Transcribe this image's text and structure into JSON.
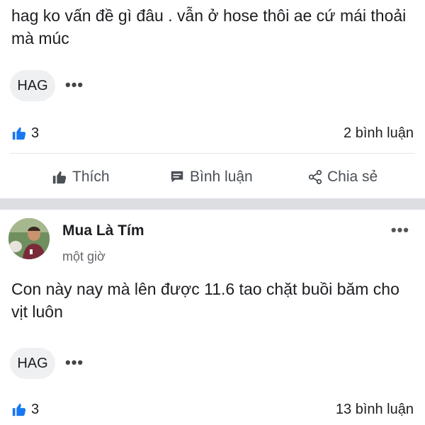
{
  "post1": {
    "body": "hag ko vấn đề gì đâu . vẫn ở hose thôi ae cứ mái thoải mà múc",
    "tag": "HAG",
    "more": "•••",
    "likes": "3",
    "comments": "2 bình luận",
    "actions": {
      "like": "Thích",
      "comment": "Bình luận",
      "share": "Chia sẻ"
    }
  },
  "post2": {
    "author": "Mua Là Tím",
    "time": "một giờ",
    "more": "•••",
    "body": "Con này nay mà lên được 11.6 tao chặt buồi băm cho vịt luôn",
    "tag": "HAG",
    "tag_more": "•••",
    "likes": "3",
    "comments": "13 bình luận"
  },
  "colors": {
    "like_blue": "#1877f2",
    "text": "#1c1e21",
    "muted": "#65676b",
    "chip_bg": "#eef0f2",
    "separator": "#dcdee2"
  },
  "icons": [
    "like-reaction-icon",
    "thumbs-up-icon",
    "comment-icon",
    "share-icon",
    "more-icon"
  ]
}
